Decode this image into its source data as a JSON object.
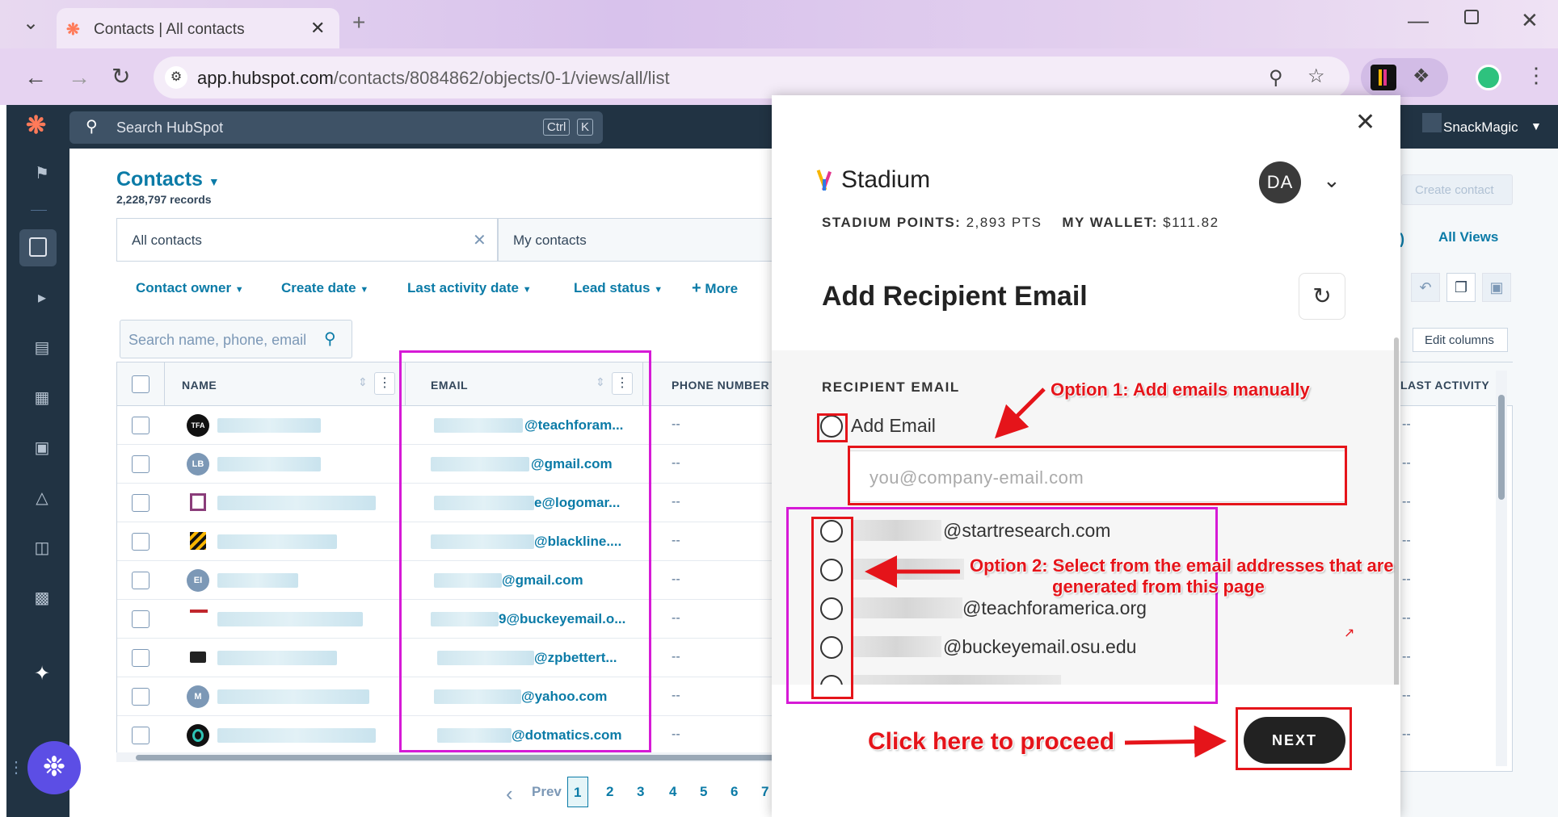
{
  "browser": {
    "tab_title": "Contacts | All contacts",
    "url_host": "app.hubspot.com",
    "url_path": "/contacts/8084862/objects/0-1/views/all/list"
  },
  "hubspot": {
    "search_placeholder": "Search HubSpot",
    "shortcut_ctrl": "Ctrl",
    "shortcut_k": "K",
    "account_name": "SnackMagic",
    "page_title": "Contacts",
    "record_count": "2,228,797 records",
    "create_contact": "Create contact",
    "all_views": "All Views",
    "edit_columns": "Edit columns",
    "view_tabs": [
      "All contacts",
      "My contacts"
    ],
    "filters": [
      "Contact owner",
      "Create date",
      "Last activity date",
      "Lead status",
      "More"
    ],
    "table_search_placeholder": "Search name, phone, email",
    "columns": {
      "name": "NAME",
      "email": "EMAIL",
      "phone": "PHONE NUMBER",
      "last_activity": "LAST ACTIVITY"
    },
    "rows": [
      {
        "avatar": "TFA",
        "email": "@teachforam...",
        "phone": "--"
      },
      {
        "avatar": "LB",
        "email": "@gmail.com",
        "phone": "--"
      },
      {
        "avatar": "",
        "email": "e@logomar...",
        "phone": "--"
      },
      {
        "avatar": "",
        "email": "@blackline....",
        "phone": "--"
      },
      {
        "avatar": "EI",
        "email": "@gmail.com",
        "phone": "--"
      },
      {
        "avatar": "",
        "email": "9@buckeyemail.o...",
        "phone": "--"
      },
      {
        "avatar": "",
        "email": "@zpbettert...",
        "phone": "--"
      },
      {
        "avatar": "M",
        "email": "@yahoo.com",
        "phone": "--"
      },
      {
        "avatar": "",
        "email": "@dotmatics.com",
        "phone": "--"
      }
    ],
    "pagination": {
      "prev": "Prev",
      "pages": [
        "1",
        "2",
        "3",
        "4",
        "5",
        "6",
        "7"
      ]
    }
  },
  "stadium": {
    "brand": "Stadium",
    "user_initials": "DA",
    "points_label": "STADIUM POINTS:",
    "points_value": "2,893 PTS",
    "wallet_label": "MY WALLET:",
    "wallet_value": "$111.82",
    "heading": "Add Recipient Email",
    "section_label": "RECIPIENT EMAIL",
    "add_email_label": "Add Email",
    "email_placeholder": "you@company-email.com",
    "recipients": [
      "@startresearch.com",
      "",
      "@teachforamerica.org",
      "@buckeyemail.osu.edu"
    ],
    "next_label": "NEXT"
  },
  "annotations": {
    "option1": "Option 1: Add emails manually",
    "option2_line1": "Option 2: Select from the email addresses that are",
    "option2_line2": "generated from this page",
    "proceed": "Click here to proceed"
  },
  "colors": {
    "hubspot_nav": "#213343",
    "link": "#0b7ba7",
    "annotation_red": "#e5141a",
    "annotation_magenta": "#d61ad6",
    "next_button": "#222222"
  }
}
